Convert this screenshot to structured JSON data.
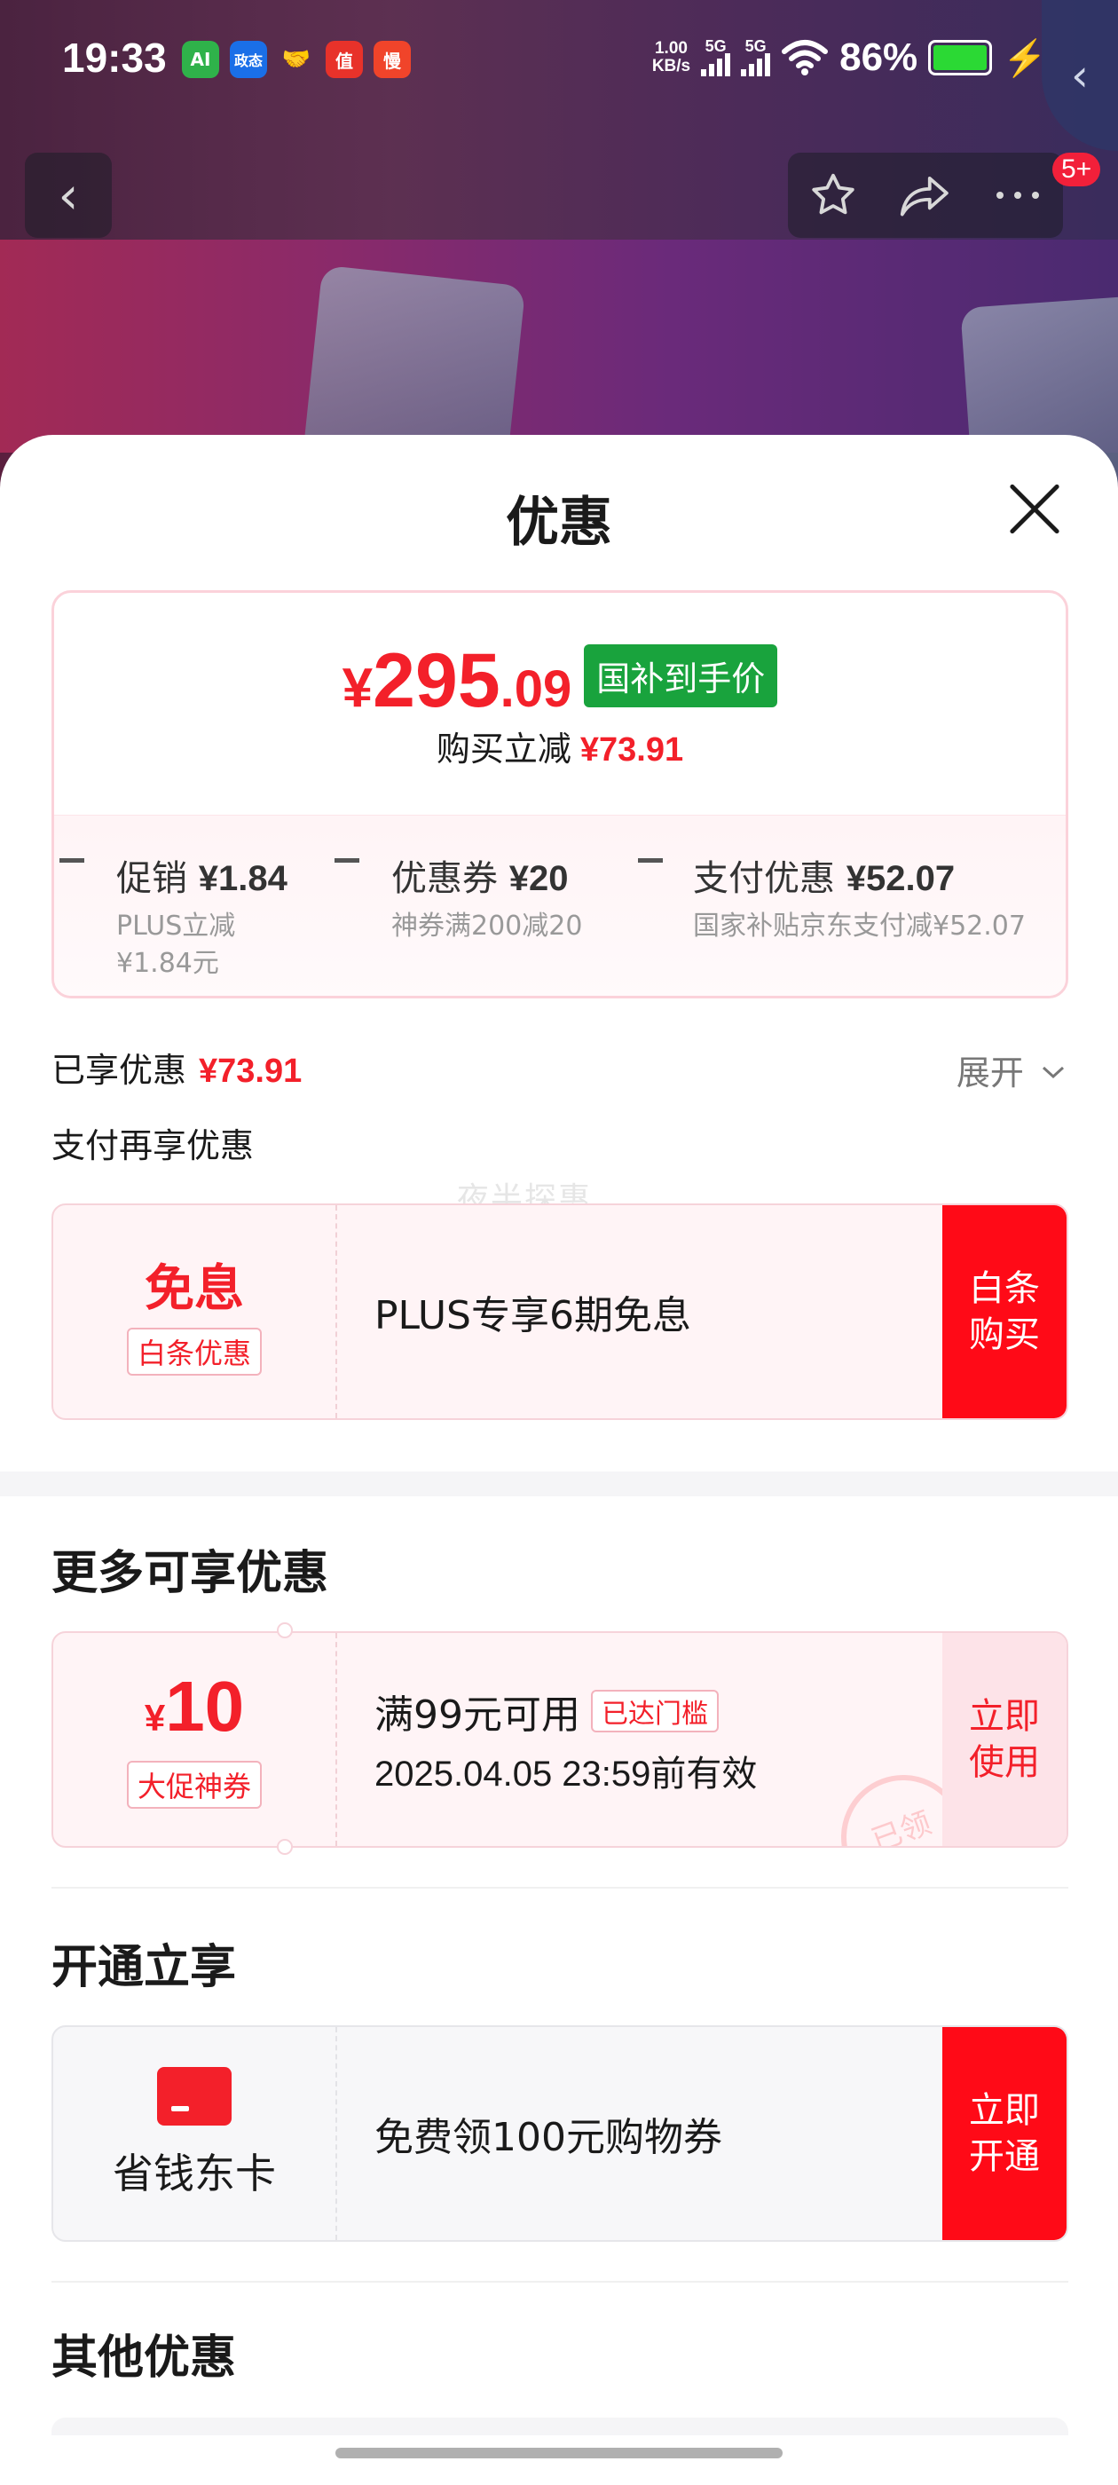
{
  "status_bar": {
    "time": "19:33",
    "net_speed_value": "1.00",
    "net_speed_unit": "KB/s",
    "sig1": "5G",
    "sig2": "5G",
    "battery": "86%",
    "apps": [
      {
        "label": "AI",
        "color": "#2fb24a"
      },
      {
        "label": "政态",
        "color": "#1a6fe8"
      },
      {
        "label": "🤝",
        "color": "transparent"
      },
      {
        "label": "值",
        "color": "#e8322a"
      },
      {
        "label": "慢",
        "color": "#f0442a"
      }
    ]
  },
  "nav": {
    "back_icon": "chevron-left-icon",
    "actions": [
      "star-icon",
      "share-icon",
      "more-icon"
    ],
    "badge": "5+"
  },
  "sheet": {
    "title": "优惠",
    "price": {
      "symbol": "¥",
      "integer": "295",
      "decimal": ".09",
      "tag": "国补到手价",
      "sub_label": "购买立减",
      "sub_value": "¥73.91"
    },
    "breakdown": [
      {
        "head_label": "促销",
        "head_value": "¥1.84",
        "sub_lines": [
          "PLUS立减",
          "¥1.84元"
        ]
      },
      {
        "head_label": "优惠券",
        "head_value": "¥20",
        "sub_lines": [
          "神券满200减20"
        ]
      },
      {
        "head_label": "支付优惠",
        "head_value": "¥52.07",
        "sub_lines": [
          "国家补贴京东支付减¥52.07"
        ]
      }
    ],
    "enjoyed_label": "已享优惠",
    "enjoyed_value": "¥73.91",
    "expand_label": "展开",
    "pay_more_label": "支付再享优惠",
    "watermark": "夜半探惠",
    "baitiao": {
      "big": "免息",
      "tag": "白条优惠",
      "text": "PLUS专享6期免息",
      "button": "白条\n购买"
    },
    "more_section_title": "更多可享优惠",
    "coupon": {
      "symbol": "¥",
      "amount": "10",
      "tag": "大促神券",
      "condition": "满99元可用",
      "status_tag": "已达门槛",
      "validity": "2025.04.05 23:59前有效",
      "button": "立即\n使用",
      "stamp": "已领"
    },
    "open_section_title": "开通立享",
    "card": {
      "name": "省钱东卡",
      "text": "免费领100元购物券",
      "button": "立即\n开通"
    },
    "other_section_title": "其他优惠"
  },
  "colors": {
    "accent_red": "#f3202a",
    "button_red": "#ff0a17",
    "tag_green": "#19a33d"
  }
}
